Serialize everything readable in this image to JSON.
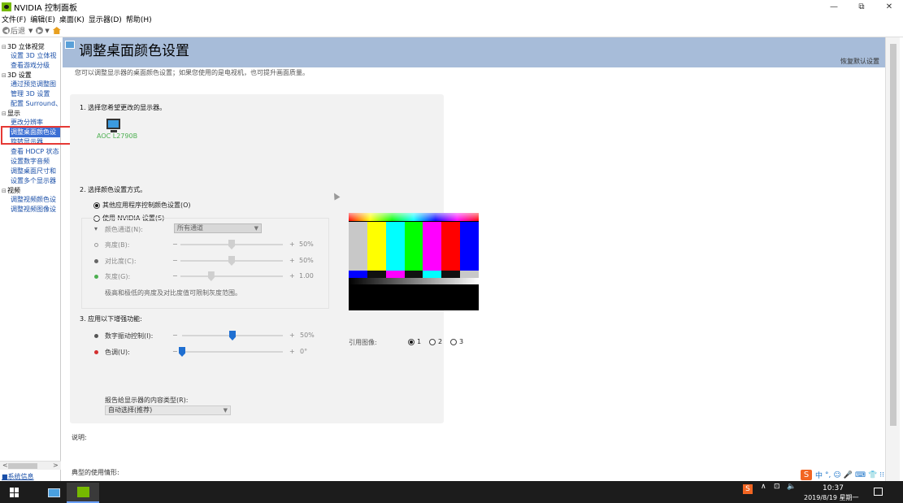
{
  "window": {
    "title": "NVIDIA 控制面板",
    "controls": {
      "minimize": "—",
      "maximize": "⧉",
      "close": "✕"
    }
  },
  "menu": [
    "文件(F)",
    "编辑(E)",
    "桌面(K)",
    "显示器(D)",
    "帮助(H)"
  ],
  "nav": {
    "back": "后退",
    "back_icon": "left-arrow-icon",
    "forward_icon": "right-arrow-icon",
    "home_icon": "home-icon"
  },
  "sidebar": {
    "groups": [
      {
        "label": "3D 立体视觉",
        "items": [
          "设置 3D 立体视",
          "查看游戏分级"
        ]
      },
      {
        "label": "3D 设置",
        "items": [
          "通过预览调整图",
          "管理 3D 设置",
          "配置 Surround、"
        ]
      },
      {
        "label": "显示",
        "items": [
          "更改分辨率",
          "调整桌面颜色设",
          "旋转显示器",
          "查看 HDCP 状态",
          "设置数字音频",
          "调整桌面尺寸和",
          "设置多个显示器"
        ]
      },
      {
        "label": "视频",
        "items": [
          "调整视频颜色设",
          "调整视频图像设"
        ]
      }
    ],
    "selected": "调整桌面颜色设",
    "system_info": "系统信息"
  },
  "page": {
    "title": "调整桌面颜色设置",
    "restore_defaults": "恢复默认设置",
    "subtitle": "您可以调整显示器的桌面颜色设置；如果您使用的是电视机，也可提升画面质量。",
    "step1": "1. 选择您希望更改的显示器。",
    "monitor_name": "AOC L2790B",
    "step2": "2. 选择颜色设置方式。",
    "radio_app": "其他应用程序控制颜色设置(O)",
    "radio_nvidia": "使用 NVIDIA 设置(S)",
    "channel_label": "颜色通道(N):",
    "channel_value": "所有通道",
    "brightness_label": "亮度(B):",
    "brightness_value": "50%",
    "brightness_fraction": 0.5,
    "contrast_label": "对比度(C):",
    "contrast_value": "50%",
    "contrast_fraction": 0.5,
    "gamma_label": "灰度(G):",
    "gamma_value": "1.00",
    "gamma_fraction": 0.3,
    "range_note": "极高和极低的亮度及对比度值可限制灰度范围。",
    "step3": "3. 应用以下增强功能:",
    "vibrance_label": "数字振动控制(I):",
    "vibrance_value": "50%",
    "vibrance_fraction": 0.5,
    "hue_label": "色调(U):",
    "hue_value": "0°",
    "hue_fraction": 0.0,
    "minus": "−",
    "plus": "+",
    "ref_image_label": "引用图像:",
    "ref_options": [
      "1",
      "2",
      "3"
    ],
    "ref_selected": "1",
    "content_type_label": "报告给显示器的内容类型(R):",
    "content_type_value": "自动选择(推荐)",
    "description_label": "说明:",
    "usage_label": "典型的使用情形:"
  },
  "ime": {
    "logo": "S",
    "symbols": [
      "中",
      "°,",
      "☺",
      "🎤",
      "⌨",
      "👕",
      "⁝⁝"
    ]
  },
  "taskbar": {
    "time": "10:37",
    "date": "2019/8/19 星期一",
    "tray_symbols": [
      "∧",
      "⊡",
      "🔈"
    ]
  },
  "colors": {
    "header_bg": "#a7bcd9",
    "panel_bg": "#f2f2f2",
    "selection": "#3b6fd4",
    "link": "#1a4fa8",
    "highlight_box": "#e53935",
    "nvidia_green": "#76b900",
    "slider_blue": "#1f6fd1"
  },
  "test_pattern": {
    "bars": [
      "#c8c8c8",
      "#ffff00",
      "#00ffff",
      "#00ff00",
      "#ff00ff",
      "#ff0000",
      "#0000ff"
    ],
    "minibars": [
      "#0000ff",
      "#111111",
      "#ff00ff",
      "#111111",
      "#00ffff",
      "#111111",
      "#c8c8c8"
    ],
    "bottom": [
      "#0a3a5a",
      "#ffffff",
      "#3a1070",
      "#101010",
      "#101010"
    ]
  }
}
